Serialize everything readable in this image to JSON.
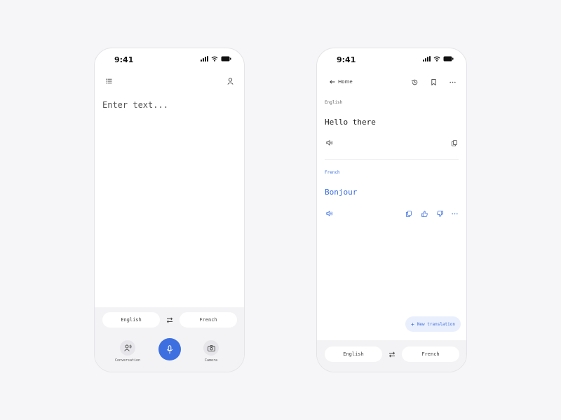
{
  "colors": {
    "background": "#f6f6f8",
    "accent": "#3d6fe0",
    "panel": "#f3f3f5",
    "text": "#222222"
  },
  "screen_input": {
    "status_time": "9:41",
    "menu_icon": "list-icon",
    "profile_icon": "person-icon",
    "input_placeholder": "Enter text...",
    "source_language": "English",
    "target_language": "French",
    "swap_icon": "swap-arrows-icon",
    "actions": {
      "conversation_label": "Conversation",
      "conversation_icon": "people-icon",
      "mic_icon": "microphone-icon",
      "camera_label": "Camera",
      "camera_icon": "camera-icon"
    }
  },
  "screen_result": {
    "status_time": "9:41",
    "back_label": "Home",
    "header_icons": [
      "history-icon",
      "bookmark-icon",
      "more-icon"
    ],
    "source": {
      "language": "English",
      "text": "Hello there"
    },
    "target": {
      "language": "French",
      "text": "Bonjour"
    },
    "new_translation_label": "New translation",
    "source_language": "English",
    "target_language": "French"
  }
}
